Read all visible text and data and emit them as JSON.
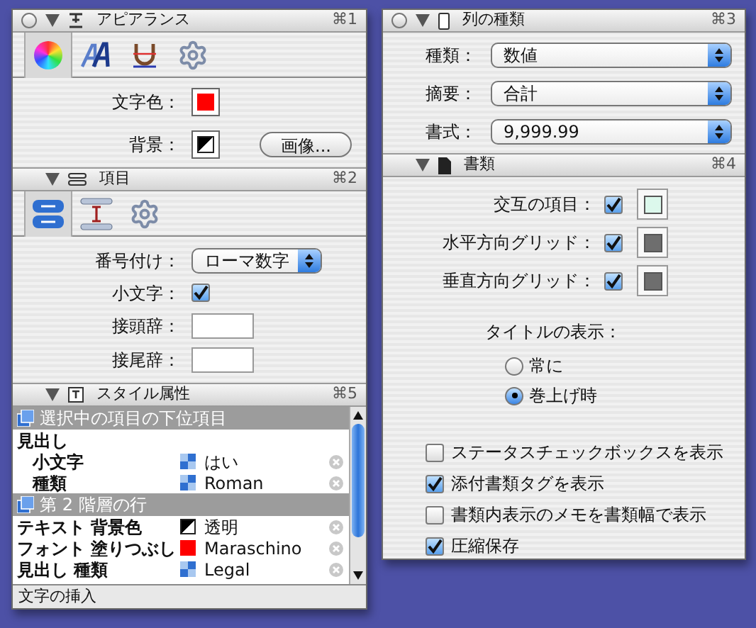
{
  "left_panel": {
    "appearance": {
      "title": "アピアランス",
      "shortcut": "⌘1",
      "expanded": true,
      "tools": [
        {
          "kind": "color-wheel",
          "selected": true
        },
        {
          "kind": "font",
          "selected": false
        },
        {
          "kind": "underline",
          "selected": false
        },
        {
          "kind": "gear",
          "selected": false
        }
      ],
      "text_color": {
        "label": "文字色：",
        "color": "#ff0000"
      },
      "background": {
        "label": "背景：",
        "button": "画像..."
      }
    },
    "items": {
      "title": "項目",
      "shortcut": "⌘2",
      "expanded": true,
      "tools": [
        {
          "kind": "numbering",
          "selected": true
        },
        {
          "kind": "spacing",
          "selected": false
        },
        {
          "kind": "gear",
          "selected": false
        }
      ],
      "numbering": {
        "label": "番号付け：",
        "value": "ローマ数字"
      },
      "lowercase": {
        "label": "小文字：",
        "checked": true
      },
      "prefix": {
        "label": "接頭辞："
      },
      "suffix": {
        "label": "接尾辞："
      }
    },
    "style_attributes": {
      "title": "スタイル属性",
      "shortcut": "⌘5",
      "expanded": true,
      "rows": [
        {
          "kind": "group",
          "label": "選択中の項目の下位項目"
        },
        {
          "kind": "heading",
          "label": "見出し",
          "children": [
            {
              "kind": "attribute",
              "name": "小文字",
              "swatch": {
                "kind": "pattern"
              },
              "value": "はい"
            },
            {
              "kind": "attribute",
              "name": "種類",
              "swatch": {
                "kind": "pattern"
              },
              "value": "Roman"
            }
          ]
        },
        {
          "kind": "group",
          "label": "第 2 階層の行"
        },
        {
          "kind": "attribute",
          "name": "テキスト 背景色",
          "swatch": {
            "kind": "diagonal"
          },
          "value": "透明"
        },
        {
          "kind": "attribute",
          "name": "フォント 塗りつぶし",
          "swatch": {
            "kind": "color",
            "color": "#ff0000"
          },
          "value": "Maraschino"
        },
        {
          "kind": "attribute",
          "name": "見出し 種類",
          "swatch": {
            "kind": "pattern"
          },
          "value": "Legal"
        }
      ]
    },
    "status_bar": "文字の挿入"
  },
  "right_panel": {
    "column_type": {
      "title": "列の種類",
      "shortcut": "⌘3",
      "expanded": true,
      "popups": [
        {
          "label": "種類：",
          "value": "数値"
        },
        {
          "label": "摘要：",
          "value": "合計"
        },
        {
          "label": "書式：",
          "value": "9,999.99"
        }
      ]
    },
    "document": {
      "title": "書類",
      "shortcut": "⌘4",
      "expanded": true,
      "color_rows": [
        {
          "label": "交互の項目：",
          "checked": true,
          "color": "#dcf8ec"
        },
        {
          "label": "水平方向グリッド：",
          "checked": true,
          "color": "#6e6e6e"
        },
        {
          "label": "垂直方向グリッド：",
          "checked": true,
          "color": "#6e6e6e"
        }
      ],
      "title_display": {
        "label": "タイトルの表示：",
        "options": [
          {
            "label": "常に",
            "selected": false
          },
          {
            "label": "巻上げ時",
            "selected": true
          }
        ]
      },
      "checkboxes": [
        {
          "label": "ステータスチェックボックスを表示",
          "checked": false
        },
        {
          "label": "添付書類タグを表示",
          "checked": true
        },
        {
          "label": "書類内表示のメモを書類幅で表示",
          "checked": false
        },
        {
          "label": "圧縮保存",
          "checked": true
        }
      ]
    }
  }
}
